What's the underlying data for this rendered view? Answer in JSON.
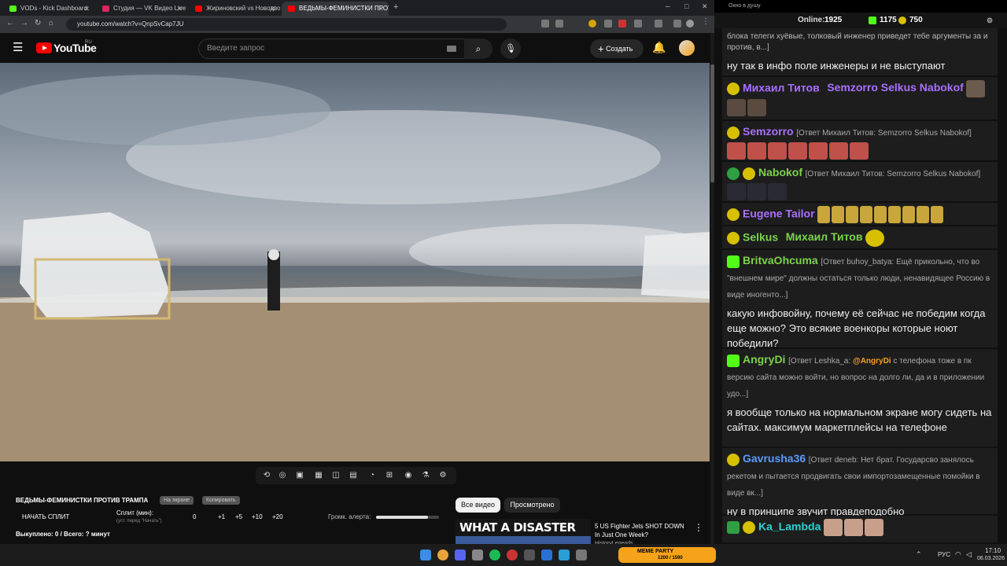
{
  "browser": {
    "tabs": [
      {
        "label": "VODs - Kick Dashboard",
        "color": "#53fc18"
      },
      {
        "label": "Студия — VK Видео Live",
        "color": "#e0245e"
      },
      {
        "label": "Жириновский vs Новодворская",
        "color": "#ff0000"
      },
      {
        "label": "ВЕДЬМЫ-ФЕМИНИСТКИ ПРОТ",
        "color": "#ff0000"
      }
    ],
    "url": "youtube.com/watch?v=QnpSvCap7JU"
  },
  "youtube": {
    "logo": "YouTube",
    "region": "RU",
    "search_placeholder": "Введите запрос",
    "create_label": "Создать"
  },
  "panel": {
    "video_title": "ВЕДЬМЫ-ФЕМИНИСТКИ ПРОТИВ ТРАМПА",
    "chip1": "На экране",
    "chip2": "Копировать",
    "start_split": "НАЧАТЬ СПЛИТ",
    "split_label": "Сплит (мин):",
    "split_hint": "(уст. перед \"Начать\")",
    "buttons": [
      "0",
      "+1",
      "+5",
      "+10",
      "+20"
    ],
    "volume_label": "Громк. алерта:",
    "volume_level": 0.82,
    "bought": "Выкуплено: 0 / Всего: ? минут",
    "tab_all": "Все видео",
    "tab_watched": "Просмотрено",
    "rec_thumb_text": "WHAT A DISASTER",
    "rec_title": "5 US Fighter Jets SHOT DOWN In Just One Week?",
    "rec_channel": "HistoryLegends"
  },
  "chat": {
    "window_title": "Окно в душу",
    "online_label": "Online:",
    "online_count": "1925",
    "kick_count": "1175",
    "other_count": "750",
    "messages": [
      {
        "text": "блока телеги хуёвые, толковый инженер приведет тебе аргументы за и против, в...]",
        "text2": "ну так в инфо поле инженеры и не выступают"
      },
      {
        "nick": "Михаил Титов",
        "color": "#a970ff",
        "mention": "Semzorro Selkus Nabokof"
      },
      {
        "nick": "Semzorro",
        "color": "#a970ff",
        "reply": "[Ответ Михаил Титов: Semzorro Selkus Nabokof]"
      },
      {
        "nick": "Nabokof",
        "color": "#7bd34b",
        "reply": "[Ответ Михаил Титов: Semzorro Selkus Nabokof]"
      },
      {
        "nick": "Eugene Tailor",
        "color": "#a970ff"
      },
      {
        "nick": "Selkus",
        "color": "#7bd34b",
        "mention": "Михаил Титов"
      },
      {
        "nick": "BritvaOhcuma",
        "color": "#7bd34b",
        "reply": "[Ответ buhoy_batya: Ещё прикольно, что во \"внешнем мире\" должны остаться только люди, ненавидящее Россию в виде иногенто...]",
        "text": "какую инфовойну, почему её сейчас не победим когда еще можно? Это всякие военкоры которые ноют победили?"
      },
      {
        "nick": "AngryDi",
        "color": "#7bd34b",
        "reply_prefix": "[Ответ Leshka_a: ",
        "reply_mention": "@AngryDi",
        "reply_rest": " с телефона тоже в пк версию сайта можно войти, но вопрос на долго ли, да и в приложении удо...]",
        "text": "я вообще только на нормальном экране могу сидеть на сайтах. максимум маркетплейсы на телефоне"
      },
      {
        "nick": "Gavrusha36",
        "color": "#5b9bff",
        "reply": "[Ответ deneb: Нет брат. Государсво занялось рекетом и пытается продвигать свои импортозамещенные помойки в виде вк...]",
        "text": "ну в принципе звучит правдеподобно"
      },
      {
        "nick": "Ka_Lambda",
        "color": "#2fd1d1"
      }
    ]
  },
  "taskbar": {
    "lang": "РУС",
    "time": "17:10",
    "date": "06.03.2026",
    "widget": "MEME PARTY",
    "widget_vals": "1200 / 1590"
  }
}
